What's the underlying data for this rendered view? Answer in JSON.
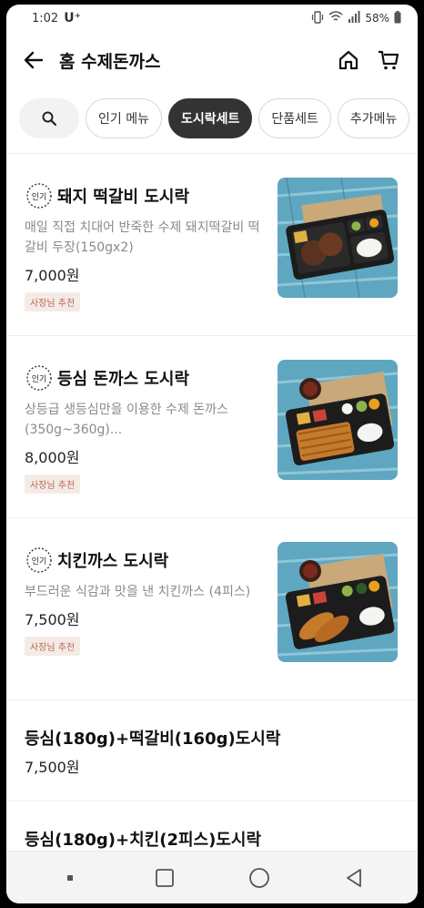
{
  "status_bar": {
    "time": "1:02",
    "carrier": "U⁺",
    "battery": "58%"
  },
  "header": {
    "title": "홈 수제돈까스",
    "icons": [
      "back-arrow-icon",
      "home-icon",
      "cart-icon"
    ]
  },
  "tabs": [
    {
      "label": "인기 메뉴",
      "active": false
    },
    {
      "label": "도시락세트",
      "active": true
    },
    {
      "label": "단품세트",
      "active": false
    },
    {
      "label": "추가메뉴",
      "active": false
    }
  ],
  "popular_badge": "인기",
  "menu": [
    {
      "name": "돼지 떡갈비 도시락",
      "desc": "매일 직접 치대어 반죽한 수제 돼지떡갈비 떡갈비 두장(150gx2)",
      "price": "7,000원",
      "tag": "사장님 추천"
    },
    {
      "name": "등심 돈까스 도시락",
      "desc": "상등급 생등심만을 이용한 수제 돈까스 (350g~360g)...",
      "price": "8,000원",
      "tag": "사장님 추천"
    },
    {
      "name": "치킨까스 도시락",
      "desc": "부드러운 식감과 맛을 낸 치킨까스 (4피스)",
      "price": "7,500원",
      "tag": "사장님 추천"
    },
    {
      "name": "등심(180g)+떡갈비(160g)도시락",
      "price": "7,500원"
    },
    {
      "name": "등심(180g)+치킨(2피스)도시락"
    }
  ],
  "colors": {
    "active_tab": "#333333",
    "tag_bg": "#f5ebe6",
    "tag_text": "#b56a50",
    "wood_blue": "#5fa7c0"
  }
}
